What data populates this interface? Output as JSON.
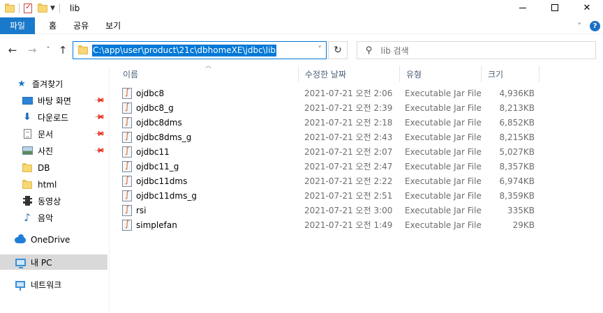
{
  "window": {
    "title": "lib"
  },
  "ribbon": {
    "tabs": [
      "파일",
      "홈",
      "공유",
      "보기"
    ]
  },
  "nav": {
    "address": "C:\\app\\user\\product\\21c\\dbhomeXE\\jdbc\\lib",
    "search_placeholder": "lib 검색"
  },
  "sidebar": {
    "items": [
      {
        "label": "즐겨찾기",
        "icon": "star-icon",
        "pinned": false
      },
      {
        "label": "바탕 화면",
        "icon": "desktop-icon",
        "pinned": true
      },
      {
        "label": "다운로드",
        "icon": "download-icon",
        "pinned": true
      },
      {
        "label": "문서",
        "icon": "document-icon",
        "pinned": true
      },
      {
        "label": "사진",
        "icon": "pictures-icon",
        "pinned": true
      },
      {
        "label": "DB",
        "icon": "folder-icon",
        "pinned": false
      },
      {
        "label": "html",
        "icon": "folder-icon",
        "pinned": false
      },
      {
        "label": "동영상",
        "icon": "video-icon",
        "pinned": false
      },
      {
        "label": "음악",
        "icon": "music-icon",
        "pinned": false
      },
      {
        "label": "OneDrive",
        "icon": "onedrive-icon",
        "pinned": false
      },
      {
        "label": "내 PC",
        "icon": "this-pc-icon",
        "pinned": false,
        "selected": true
      },
      {
        "label": "네트워크",
        "icon": "network-icon",
        "pinned": false
      }
    ]
  },
  "columns": {
    "name": "이름",
    "date": "수정한 날짜",
    "type": "유형",
    "size": "크기"
  },
  "files": [
    {
      "name": "ojdbc8",
      "date": "2021-07-21 오전 2:06",
      "type": "Executable Jar File",
      "size": "4,936KB"
    },
    {
      "name": "ojdbc8_g",
      "date": "2021-07-21 오전 2:39",
      "type": "Executable Jar File",
      "size": "8,213KB"
    },
    {
      "name": "ojdbc8dms",
      "date": "2021-07-21 오전 2:18",
      "type": "Executable Jar File",
      "size": "6,852KB"
    },
    {
      "name": "ojdbc8dms_g",
      "date": "2021-07-21 오전 2:43",
      "type": "Executable Jar File",
      "size": "8,215KB"
    },
    {
      "name": "ojdbc11",
      "date": "2021-07-21 오전 2:07",
      "type": "Executable Jar File",
      "size": "5,027KB"
    },
    {
      "name": "ojdbc11_g",
      "date": "2021-07-21 오전 2:47",
      "type": "Executable Jar File",
      "size": "8,357KB"
    },
    {
      "name": "ojdbc11dms",
      "date": "2021-07-21 오전 2:22",
      "type": "Executable Jar File",
      "size": "6,974KB"
    },
    {
      "name": "ojdbc11dms_g",
      "date": "2021-07-21 오전 2:51",
      "type": "Executable Jar File",
      "size": "8,359KB"
    },
    {
      "name": "rsi",
      "date": "2021-07-21 오전 3:00",
      "type": "Executable Jar File",
      "size": "335KB"
    },
    {
      "name": "simplefan",
      "date": "2021-07-21 오전 1:49",
      "type": "Executable Jar File",
      "size": "29KB"
    }
  ],
  "colors": {
    "accent": "#0078d7",
    "file_tab": "#1979ca",
    "selection": "#d9d9d9"
  }
}
